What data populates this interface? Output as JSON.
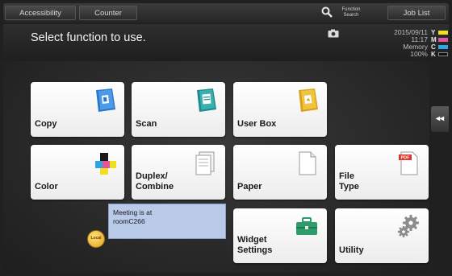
{
  "topbar": {
    "accessibility_label": "Accessibility",
    "counter_label": "Counter",
    "function_search_label": "Function Search",
    "job_list_label": "Job List"
  },
  "header": {
    "prompt": "Select function to use.",
    "date": "2015/09/11",
    "time": "11:17",
    "memory_label": "Memory",
    "memory_value": "100%",
    "toner": [
      {
        "letter": "Y",
        "color": "#f1e11c"
      },
      {
        "letter": "M",
        "color": "#e0559d"
      },
      {
        "letter": "C",
        "color": "#2fa6e2"
      },
      {
        "letter": "K",
        "color": "#2a2a2a"
      }
    ]
  },
  "tiles": {
    "copy": "Copy",
    "scan": "Scan",
    "user_box": "User Box",
    "color": "Color",
    "duplex_combine_1": "Duplex/",
    "duplex_combine_2": "Combine",
    "paper": "Paper",
    "file_type_1": "File",
    "file_type_2": "Type",
    "widget_settings_1": "Widget",
    "widget_settings_2": "Settings",
    "utility": "Utility"
  },
  "message": {
    "line1": "Meeting is at",
    "line2": "roomC266",
    "badge": "Local"
  },
  "side_button": {
    "label": "◂◂"
  },
  "colors": {
    "copy_icon": "#2a78c9",
    "scan_icon": "#1e8c8c",
    "userbox_icon": "#d9a21a",
    "widget_icon": "#2e9b6a",
    "pdf_red": "#d9342b"
  }
}
